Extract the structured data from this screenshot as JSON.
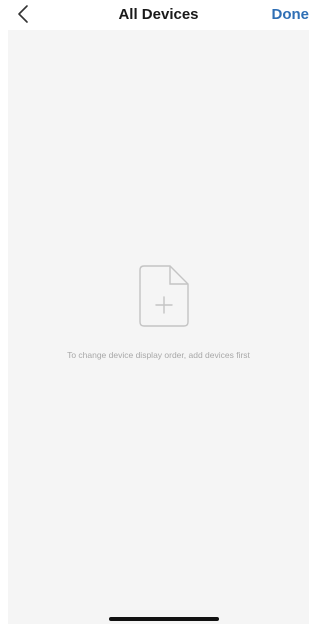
{
  "header": {
    "title": "All Devices",
    "done_label": "Done",
    "back_icon": "chevron-left-icon"
  },
  "empty_state": {
    "icon": "add-file-icon",
    "message": "To change device display order, add devices first"
  },
  "colors": {
    "accent": "#2f6fb5",
    "background": "#f5f5f5",
    "muted_text": "#a8a8a8",
    "icon_stroke": "#c4c4c4"
  }
}
